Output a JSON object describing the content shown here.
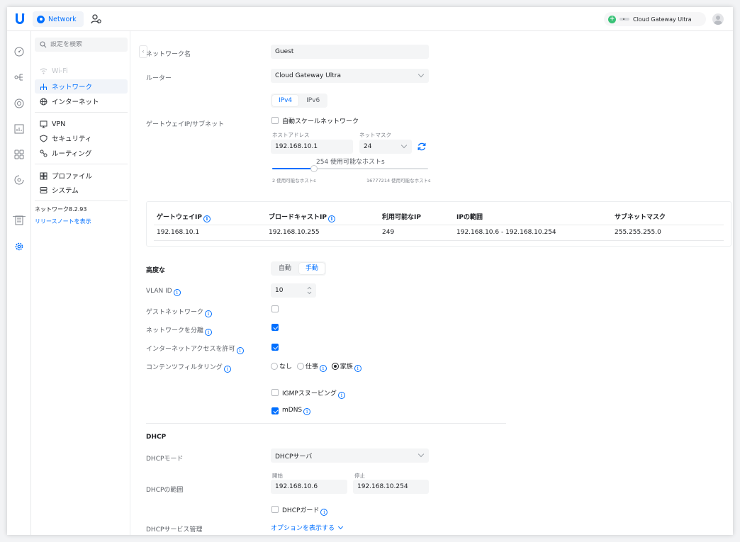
{
  "app": {
    "name": "Network"
  },
  "console": {
    "name": "Cloud Gateway Ultra"
  },
  "sidebar": {
    "search_placeholder": "設定を検索",
    "items": [
      {
        "label": "Wi-Fi"
      },
      {
        "label": "ネットワーク"
      },
      {
        "label": "インターネット"
      },
      {
        "label": "VPN"
      },
      {
        "label": "セキュリティ"
      },
      {
        "label": "ルーティング"
      },
      {
        "label": "プロファイル"
      },
      {
        "label": "システム"
      }
    ],
    "version": "ネットワーク8.2.93",
    "release_notes": "リリースノートを表示"
  },
  "form": {
    "network_name_label": "ネットワーク名",
    "network_name_value": "Guest",
    "router_label": "ルーター",
    "router_value": "Cloud Gateway Ultra",
    "ip_tabs": [
      "IPv4",
      "IPv6"
    ],
    "gateway_label": "ゲートウェイIP/サブネット",
    "auto_scale_label": "自動スケールネットワーク",
    "host_address_label": "ホストアドレス",
    "host_address_value": "192.168.10.1",
    "netmask_label": "ネットマスク",
    "netmask_value": "24",
    "usable_hosts": "254 使用可能なホストs",
    "slider_min_label": "2 使用可能なホストs",
    "slider_max_label": "16777214 使用可能なホストs",
    "slider_fraction": 0.27
  },
  "subnet_table": {
    "headers": [
      "ゲートウェイIP",
      "ブロードキャストIP",
      "利用可能なIP",
      "IPの範囲",
      "サブネットマスク"
    ],
    "row": [
      "192.168.10.1",
      "192.168.10.255",
      "249",
      "192.168.10.6 - 192.168.10.254",
      "255.255.255.0"
    ]
  },
  "advanced": {
    "title": "高度な",
    "mode_options": [
      "自動",
      "手動"
    ],
    "vlan_label": "VLAN ID",
    "vlan_value": "10",
    "guest_network_label": "ゲストネットワーク",
    "isolate_label": "ネットワークを分離",
    "internet_access_label": "インターネットアクセスを許可",
    "content_filter_label": "コンテンツフィルタリング",
    "content_filter_options": [
      "なし",
      "仕事",
      "家族"
    ],
    "igmp_label": "IGMPスヌーピング",
    "mdns_label": "mDNS"
  },
  "dhcp": {
    "title": "DHCP",
    "mode_label": "DHCPモード",
    "mode_value": "DHCPサーバ",
    "range_label": "DHCPの範囲",
    "start_label": "開始",
    "start_value": "192.168.10.6",
    "end_label": "停止",
    "end_value": "192.168.10.254",
    "guard_label": "DHCPガード",
    "service_label": "DHCPサービス管理",
    "show_options": "オプションを表示する"
  },
  "colors": {
    "accent": "#006fff",
    "success": "#39c277"
  }
}
